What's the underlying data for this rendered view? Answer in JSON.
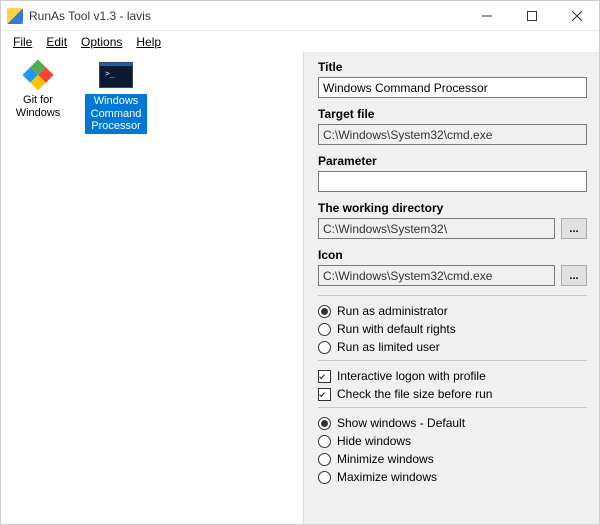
{
  "window": {
    "title": "RunAs Tool v1.3 - lavis"
  },
  "menu": {
    "file": "File",
    "edit": "Edit",
    "options": "Options",
    "help": "Help"
  },
  "shortcuts": [
    {
      "label": "Git for Windows",
      "selected": false,
      "icon": "git"
    },
    {
      "label": "Windows Command Processor",
      "selected": true,
      "icon": "cmd"
    }
  ],
  "fields": {
    "title": {
      "label": "Title",
      "value": "Windows Command Processor"
    },
    "target": {
      "label": "Target file",
      "value": "C:\\Windows\\System32\\cmd.exe"
    },
    "parameter": {
      "label": "Parameter",
      "value": ""
    },
    "workdir": {
      "label": "The working directory",
      "value": "C:\\Windows\\System32\\",
      "browse": "..."
    },
    "icon": {
      "label": "Icon",
      "value": "C:\\Windows\\System32\\cmd.exe",
      "browse": "..."
    }
  },
  "run_mode": {
    "admin": "Run as administrator",
    "default": "Run with default rights",
    "limited": "Run as limited user",
    "selected": "admin"
  },
  "options": {
    "interactive": {
      "label": "Interactive logon with profile",
      "checked": true
    },
    "check_size": {
      "label": "Check the file size before run",
      "checked": true
    }
  },
  "window_mode": {
    "show": "Show windows - Default",
    "hide": "Hide windows",
    "min": "Minimize windows",
    "max": "Maximize windows",
    "selected": "show"
  }
}
